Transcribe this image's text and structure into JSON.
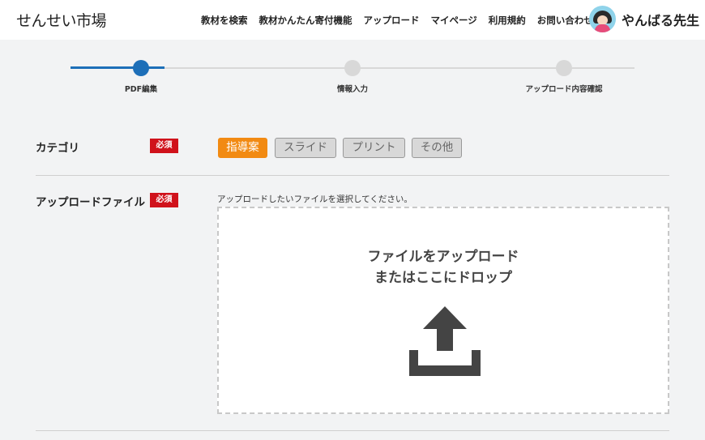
{
  "header": {
    "logo": "せんせい市場",
    "nav": [
      "教材を検索",
      "教材かんたん寄付機能",
      "アップロード",
      "マイページ",
      "利用規約",
      "お問い合わせ"
    ],
    "user_name": "やんばる先生"
  },
  "stepper": {
    "steps": [
      "PDF編集",
      "情報入力",
      "アップロード内容確認"
    ],
    "current_step": 1
  },
  "form": {
    "required_label": "必須",
    "category": {
      "label": "カテゴリ",
      "options": [
        "指導案",
        "スライド",
        "プリント",
        "その他"
      ],
      "selected": "指導案"
    },
    "upload": {
      "label": "アップロードファイル",
      "hint": "アップロードしたいファイルを選択してください。",
      "drop_line1": "ファイルをアップロード",
      "drop_line2": "またはここにドロップ"
    }
  },
  "colors": {
    "accent_blue": "#1d6fb8",
    "selected_orange": "#f28a12",
    "required_red": "#d0121b"
  }
}
